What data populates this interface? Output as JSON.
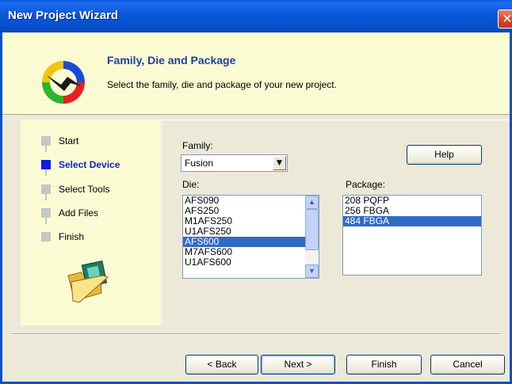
{
  "window": {
    "title": "New Project Wizard",
    "close_glyph": "✕"
  },
  "header": {
    "title": "Family, Die and Package",
    "subtitle": "Select the family, die and package of your new project.",
    "logo_icon": "wizard-arrows-icon"
  },
  "steps": [
    {
      "label": "Start",
      "active": false
    },
    {
      "label": "Select Device",
      "active": true
    },
    {
      "label": "Select Tools",
      "active": false
    },
    {
      "label": "Add Files",
      "active": false
    },
    {
      "label": "Finish",
      "active": false
    }
  ],
  "form": {
    "family_label": "Family:",
    "family_value": "Fusion",
    "die_label": "Die:",
    "die_items": [
      "AFS090",
      "AFS250",
      "M1AFS250",
      "U1AFS250",
      "AFS600",
      "M7AFS600",
      "U1AFS600"
    ],
    "die_selected": "AFS600",
    "package_label": "Package:",
    "package_items": [
      "208 PQFP",
      "256 FBGA",
      "484 FBGA"
    ],
    "package_selected": "484 FBGA",
    "help_label": "Help"
  },
  "buttons": {
    "back": "< Back",
    "next": "Next >",
    "finish": "Finish",
    "cancel": "Cancel"
  },
  "colors": {
    "titlebar": "#0550cc",
    "panel_bg": "#fbfbd3",
    "selection": "#316ac5",
    "active_step": "#0a1de0"
  }
}
